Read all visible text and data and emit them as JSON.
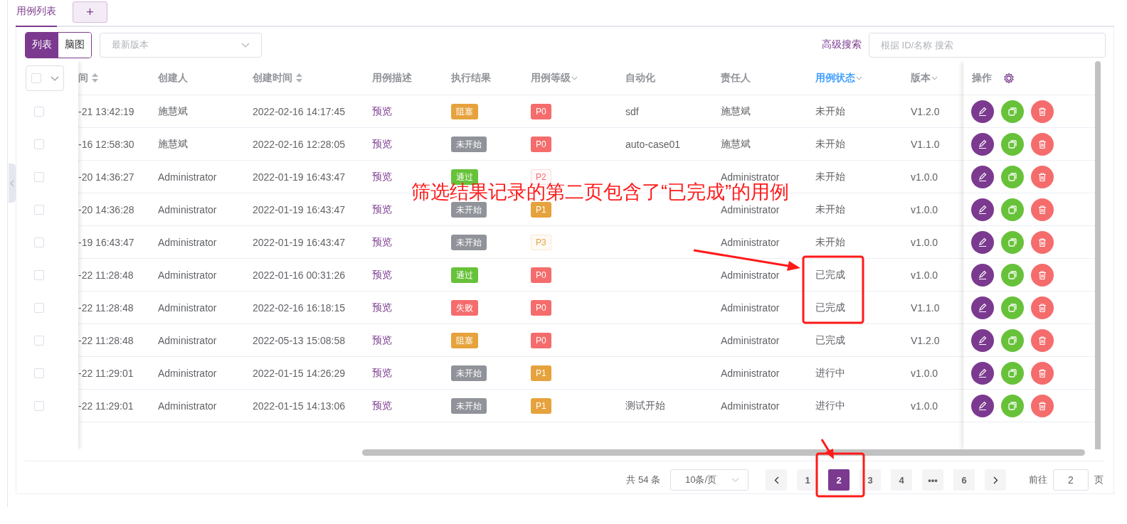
{
  "tabs": [
    {
      "label": "用例列表",
      "selected": true
    }
  ],
  "add_tab": "+",
  "view_toggle": [
    {
      "label": "列表",
      "selected": true
    },
    {
      "label": "脑图",
      "selected": false
    }
  ],
  "version_select": {
    "placeholder": "最新版本"
  },
  "advanced_search": "高级搜索",
  "search": {
    "placeholder": "根据 ID/名称 搜索"
  },
  "select_all": {
    "checked": false
  },
  "columns": [
    {
      "label": "间",
      "sortable": true,
      "filter": false,
      "active": false
    },
    {
      "label": "创建人",
      "sortable": false,
      "filter": false,
      "active": false
    },
    {
      "label": "创建时间",
      "sortable": true,
      "filter": false,
      "active": false
    },
    {
      "label": "用例描述",
      "sortable": false,
      "filter": false,
      "active": false
    },
    {
      "label": "执行结果",
      "sortable": false,
      "filter": false,
      "active": false
    },
    {
      "label": "用例等级",
      "sortable": false,
      "filter": true,
      "active": false
    },
    {
      "label": "自动化",
      "sortable": false,
      "filter": false,
      "active": false
    },
    {
      "label": "责任人",
      "sortable": false,
      "filter": false,
      "active": false
    },
    {
      "label": "用例状态",
      "sortable": false,
      "filter": true,
      "active": true
    },
    {
      "label": "版本",
      "sortable": false,
      "filter": true,
      "active": false
    }
  ],
  "ops_header": "操作",
  "rows": [
    {
      "checked": false,
      "updated": "-21 13:42:19",
      "creator": "施慧斌",
      "created": "2022-02-16 14:17:45",
      "desc": "预览",
      "result": {
        "text": "阻塞",
        "color": "#e6a23c"
      },
      "level": {
        "text": "P0",
        "color": "#f56c6c",
        "light": false
      },
      "auto": "sdf",
      "owner": "施慧斌",
      "status": "未开始",
      "version": "V1.2.0"
    },
    {
      "checked": false,
      "updated": "-16 12:58:30",
      "creator": "施慧斌",
      "created": "2022-02-16 12:28:05",
      "desc": "预览",
      "result": {
        "text": "未开始",
        "color": "#909399"
      },
      "level": {
        "text": "P0",
        "color": "#f56c6c",
        "light": false
      },
      "auto": "auto-case01",
      "owner": "施慧斌",
      "status": "未开始",
      "version": "V1.1.0"
    },
    {
      "checked": false,
      "updated": "-20 14:36:27",
      "creator": "Administrator",
      "created": "2022-01-19 16:43:47",
      "desc": "预览",
      "result": {
        "text": "通过",
        "color": "#67c23a"
      },
      "level": {
        "text": "P2",
        "color": "#f56c6c",
        "light": true
      },
      "auto": "",
      "owner": "Administrator",
      "status": "未开始",
      "version": "v1.0.0"
    },
    {
      "checked": false,
      "updated": "-20 14:36:28",
      "creator": "Administrator",
      "created": "2022-01-19 16:43:47",
      "desc": "预览",
      "result": {
        "text": "未开始",
        "color": "#909399"
      },
      "level": {
        "text": "P1",
        "color": "#e6a23c",
        "light": false
      },
      "auto": "",
      "owner": "Administrator",
      "status": "未开始",
      "version": "v1.0.0"
    },
    {
      "checked": false,
      "updated": "-19 16:43:47",
      "creator": "Administrator",
      "created": "2022-01-19 16:43:47",
      "desc": "预览",
      "result": {
        "text": "未开始",
        "color": "#909399"
      },
      "level": {
        "text": "P3",
        "color": "#e6a23c",
        "light": true
      },
      "auto": "",
      "owner": "Administrator",
      "status": "未开始",
      "version": "v1.0.0"
    },
    {
      "checked": false,
      "updated": "-22 11:28:48",
      "creator": "Administrator",
      "created": "2022-01-16 00:31:26",
      "desc": "预览",
      "result": {
        "text": "通过",
        "color": "#67c23a"
      },
      "level": {
        "text": "P0",
        "color": "#f56c6c",
        "light": false
      },
      "auto": "",
      "owner": "Administrator",
      "status": "已完成",
      "version": "v1.0.0"
    },
    {
      "checked": false,
      "updated": "-22 11:28:48",
      "creator": "Administrator",
      "created": "2022-02-16 16:18:15",
      "desc": "预览",
      "result": {
        "text": "失败",
        "color": "#f56c6c"
      },
      "level": {
        "text": "P0",
        "color": "#f56c6c",
        "light": false
      },
      "auto": "",
      "owner": "Administrator",
      "status": "已完成",
      "version": "V1.1.0"
    },
    {
      "checked": false,
      "updated": "-22 11:28:48",
      "creator": "Administrator",
      "created": "2022-05-13 15:08:58",
      "desc": "预览",
      "result": {
        "text": "阻塞",
        "color": "#e6a23c"
      },
      "level": {
        "text": "P0",
        "color": "#f56c6c",
        "light": false
      },
      "auto": "",
      "owner": "Administrator",
      "status": "已完成",
      "version": "V1.2.0"
    },
    {
      "checked": false,
      "updated": "-22 11:29:01",
      "creator": "Administrator",
      "created": "2022-01-15 14:26:29",
      "desc": "预览",
      "result": {
        "text": "未开始",
        "color": "#909399"
      },
      "level": {
        "text": "P1",
        "color": "#e6a23c",
        "light": false
      },
      "auto": "",
      "owner": "Administrator",
      "status": "进行中",
      "version": "v1.0.0"
    },
    {
      "checked": false,
      "updated": "-22 11:29:01",
      "creator": "Administrator",
      "created": "2022-01-15 14:13:06",
      "desc": "预览",
      "result": {
        "text": "未开始",
        "color": "#909399"
      },
      "level": {
        "text": "P1",
        "color": "#e6a23c",
        "light": false
      },
      "auto": "测试开始",
      "owner": "Administrator",
      "status": "进行中",
      "version": "v1.0.0"
    }
  ],
  "pagination": {
    "total": "共 54 条",
    "page_size": "10条/页",
    "pages": [
      {
        "label": "1",
        "selected": false
      },
      {
        "label": "2",
        "selected": true
      },
      {
        "label": "3",
        "selected": false
      },
      {
        "label": "4",
        "selected": false
      },
      {
        "label": "•••",
        "selected": false
      },
      {
        "label": "6",
        "selected": false
      }
    ],
    "goto_label": "前往",
    "goto_value": "2",
    "goto_suffix": "页"
  },
  "annotation": {
    "text": "筛选结果记录的第二页包含了“已完成”的用例"
  }
}
